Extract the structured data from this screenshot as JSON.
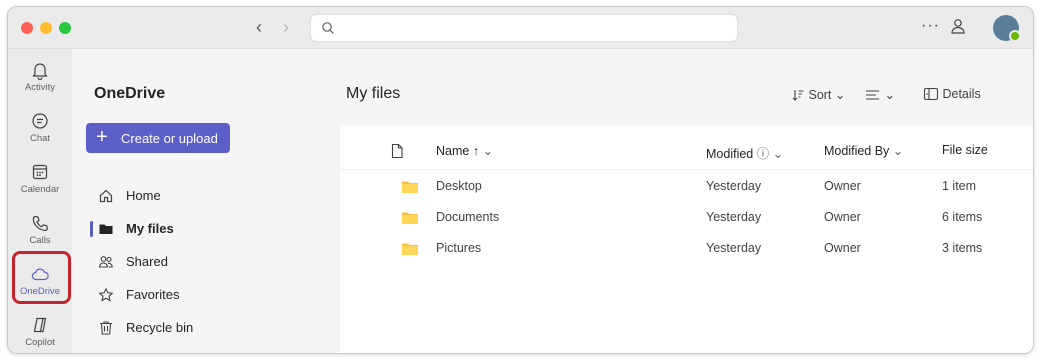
{
  "sidebar_rail": {
    "items": [
      {
        "label": "Activity",
        "icon": "bell-icon"
      },
      {
        "label": "Chat",
        "icon": "chat-icon"
      },
      {
        "label": "Calendar",
        "icon": "calendar-icon"
      },
      {
        "label": "Calls",
        "icon": "phone-icon"
      },
      {
        "label": "OneDrive",
        "icon": "cloud-icon",
        "active": true
      },
      {
        "label": "Copilot",
        "icon": "copilot-icon"
      }
    ]
  },
  "left_pane": {
    "title": "OneDrive",
    "create_button": "Create or upload",
    "nav": [
      {
        "label": "Home",
        "icon": "home-icon"
      },
      {
        "label": "My files",
        "icon": "folder-icon",
        "active": true
      },
      {
        "label": "Shared",
        "icon": "people-icon"
      },
      {
        "label": "Favorites",
        "icon": "star-icon"
      },
      {
        "label": "Recycle bin",
        "icon": "trash-icon"
      }
    ]
  },
  "main": {
    "title": "My files",
    "toolbar": {
      "sort": "Sort",
      "details": "Details"
    },
    "columns": {
      "name": "Name ↑",
      "modified": "Modified",
      "modified_by": "Modified By",
      "file_size": "File size"
    },
    "rows": [
      {
        "name": "Desktop",
        "modified": "Yesterday",
        "modified_by": "Owner",
        "file_size": "1 item"
      },
      {
        "name": "Documents",
        "modified": "Yesterday",
        "modified_by": "Owner",
        "file_size": "6 items"
      },
      {
        "name": "Pictures",
        "modified": "Yesterday",
        "modified_by": "Owner",
        "file_size": "3 items"
      }
    ]
  },
  "colors": {
    "accent": "#5b5fc7",
    "highlight": "#c4262e",
    "folder": "#f5c342",
    "presence": "#6bb700"
  }
}
